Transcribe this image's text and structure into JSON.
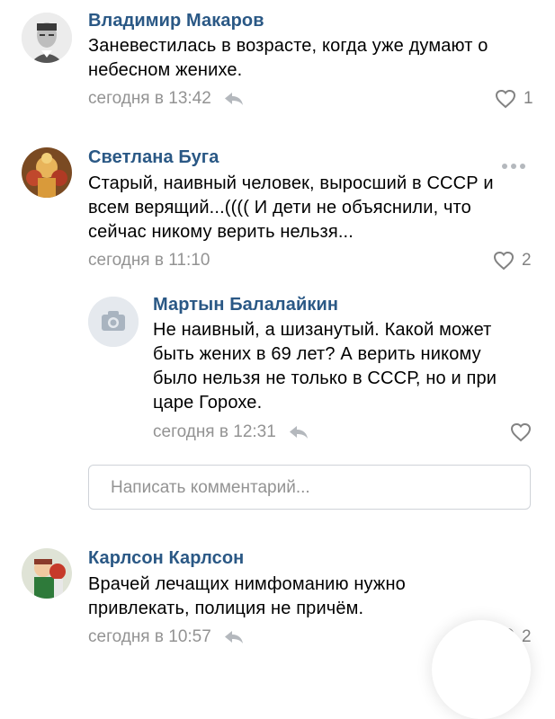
{
  "comments": [
    {
      "author": "Владимир Макаров",
      "text": "Заневестилась в возрасте, когда уже думают о\nнебесном женихе.",
      "time": "сегодня в 13:42",
      "likes": "1",
      "avatar": "man-portrait-avatar"
    },
    {
      "author": "Светлана Буга",
      "text": "Старый, наивный человек, выросший в СССР и\nвсем верящий...(((( И дети не объяснили, что\nсейчас никому верить нельзя...",
      "time": "сегодня в 11:10",
      "likes": "2",
      "avatar": "painted-figure-avatar"
    }
  ],
  "reply": {
    "author": "Мартын Балалайкин",
    "text": "Не наивный, а шизанутый. Какой может\nбыть жених в 69 лет? А верить никому\nбыло нельзя не только в СССР, но и при\nцаре Горохе.",
    "time": "сегодня в 12:31",
    "avatar": "camera-placeholder-avatar"
  },
  "comment_input": {
    "placeholder": "Написать комментарий..."
  },
  "last_comment": {
    "author": "Карлсон Карлсон",
    "text": "Врачей лечащих нимфоманию нужно\nпривлекать, полиция не причём.",
    "time": "сегодня в 10:57",
    "likes": "2",
    "avatar": "cartoon-avatar"
  },
  "colors": {
    "name": "#2a5885",
    "meta": "#939393",
    "heart": "#828282"
  }
}
